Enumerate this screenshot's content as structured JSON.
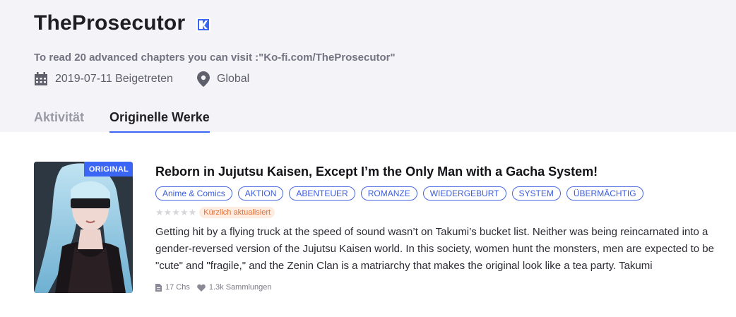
{
  "profile": {
    "name": "TheProsecutor",
    "intro": "To read 20 advanced chapters you can visit :\"Ko-fi.com/TheProsecutor\"",
    "joined": "2019-07-11 Beigetreten",
    "location": "Global"
  },
  "tabs": [
    {
      "label": "Aktivität",
      "active": false
    },
    {
      "label": "Originelle Werke",
      "active": true
    }
  ],
  "book": {
    "badge": "ORIGINAL",
    "title": "Reborn in Jujutsu Kaisen, Except I’m the Only Man with a Gacha System!",
    "tags": [
      "Anime & Comics",
      "AKTION",
      "ABENTEUER",
      "ROMANZE",
      "WIEDERGEBURT",
      "SYSTEM",
      "ÜBERMÄCHTIG"
    ],
    "rating_stars": 0,
    "updated_label": "Kürzlich aktualisiert",
    "description": "Getting hit by a flying truck at the speed of sound wasn’t on Takumi’s bucket list. Neither was being reincarnated into a gender-reversed version of the Jujutsu Kaisen world. In this society, women hunt the monsters, men are expected to be \"cute\" and \"fragile,\" and the Zenin Clan is a matriarchy that makes the original look like a tea party. Takumi",
    "chapters": "17 Chs",
    "collections": "1.3k Sammlungen"
  },
  "colors": {
    "accent": "#3b66f5",
    "header_bg": "#f3f3f8",
    "tag_blue": "#3b5bdb",
    "updated_orange": "#e0703a"
  },
  "icons": {
    "verified": "verified-author-icon",
    "calendar": "calendar-icon",
    "location": "location-pin-icon",
    "chapters": "document-icon",
    "collections": "heart-icon",
    "star": "star-icon"
  }
}
